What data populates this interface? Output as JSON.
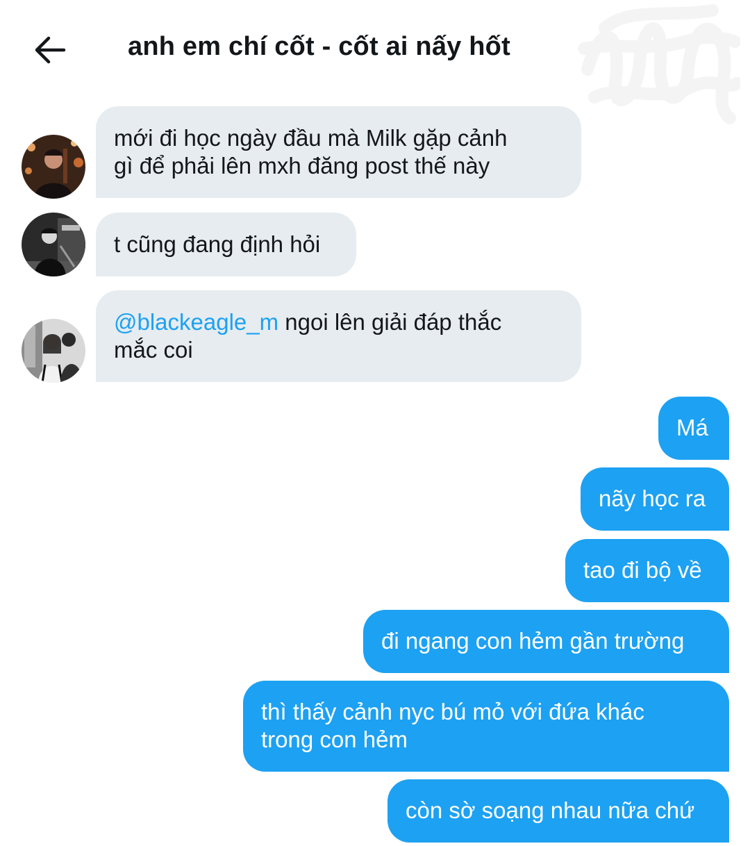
{
  "header": {
    "back_icon": "arrow-left-icon",
    "title": "anh em chí cốt - cốt ai nấy hốt",
    "redaction": "scribble-redaction"
  },
  "messages_in": [
    {
      "avatar": "avatar-photo-warm",
      "lines": [
        "mới đi học ngày đầu mà Milk gặp cảnh",
        "gì để phải lên mxh đăng post thế này"
      ]
    },
    {
      "avatar": "avatar-photo-monochrome",
      "lines": [
        "t cũng đang định hỏi"
      ]
    },
    {
      "avatar": "avatar-photo-two-people",
      "mention": "@blackeagle_m",
      "lines": [
        " ngoi lên giải đáp thắc",
        "mắc coi"
      ]
    }
  ],
  "messages_out": [
    {
      "lines": [
        "Má"
      ]
    },
    {
      "lines": [
        "nãy học ra"
      ]
    },
    {
      "lines": [
        "tao đi bộ về"
      ]
    },
    {
      "lines": [
        "đi ngang con hẻm gần trường"
      ]
    },
    {
      "lines": [
        "thì thấy cảnh nyc bú mỏ với đứa khác",
        "trong con hẻm"
      ]
    },
    {
      "lines": [
        "còn sờ soạng nhau nữa chứ"
      ]
    }
  ],
  "colors": {
    "incoming_bubble": "#e6ecf0",
    "outgoing_bubble": "#1da1f2",
    "mention": "#1da1f2",
    "text": "#14171a"
  }
}
